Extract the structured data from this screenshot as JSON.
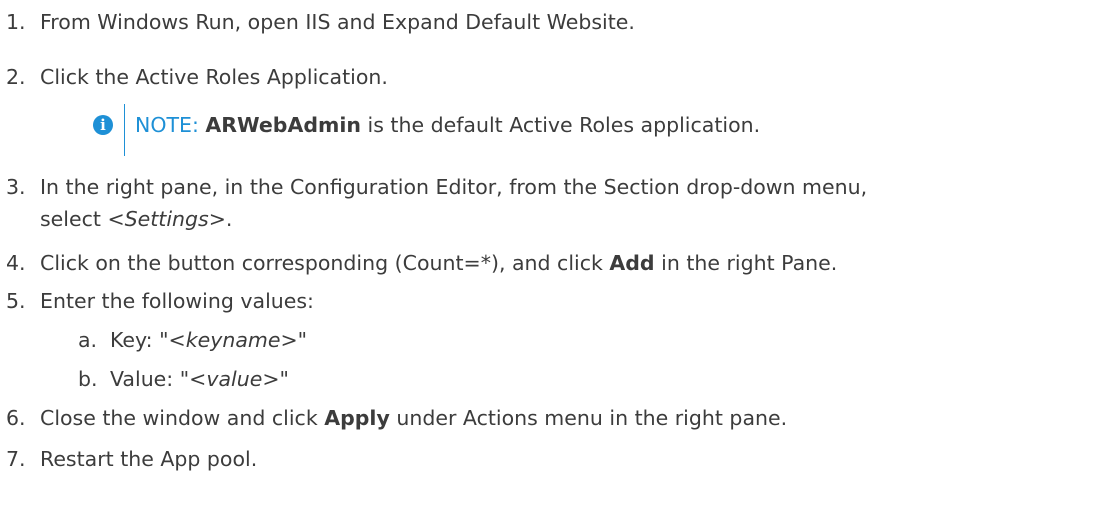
{
  "steps": [
    {
      "num": "1.",
      "text": "From Windows Run, open IIS and Expand Default Website."
    },
    {
      "num": "2.",
      "text": "Click the Active Roles Application."
    },
    {
      "num": "3.",
      "line1": "In the right pane, in the Configuration Editor, from the Section drop-down menu,",
      "line2_pre": "select ",
      "line2_em": "<Settings>",
      "line2_post": "."
    },
    {
      "num": "4.",
      "pre": "Click on the button corresponding (Count=*), and click ",
      "strong": "Add",
      "post": " in the right Pane."
    },
    {
      "num": "5.",
      "text": "Enter the following values:"
    },
    {
      "num": "6.",
      "pre": "Close the window and click ",
      "strong": "Apply",
      "post": " under Actions menu in the right pane."
    },
    {
      "num": "7.",
      "text": "Restart the App pool."
    }
  ],
  "substeps": [
    {
      "num": "a.",
      "pre": "Key: \"",
      "em": "<keyname>",
      "post": "\""
    },
    {
      "num": "b.",
      "pre": "Value: \"",
      "em": "<value>",
      "post": "\""
    }
  ],
  "note": {
    "icon_glyph": "i",
    "label": "NOTE: ",
    "strong": "ARWebAdmin",
    "text": " is the default Active Roles application."
  },
  "colors": {
    "accent": "#1e90d6",
    "text": "#3c3c3c"
  }
}
